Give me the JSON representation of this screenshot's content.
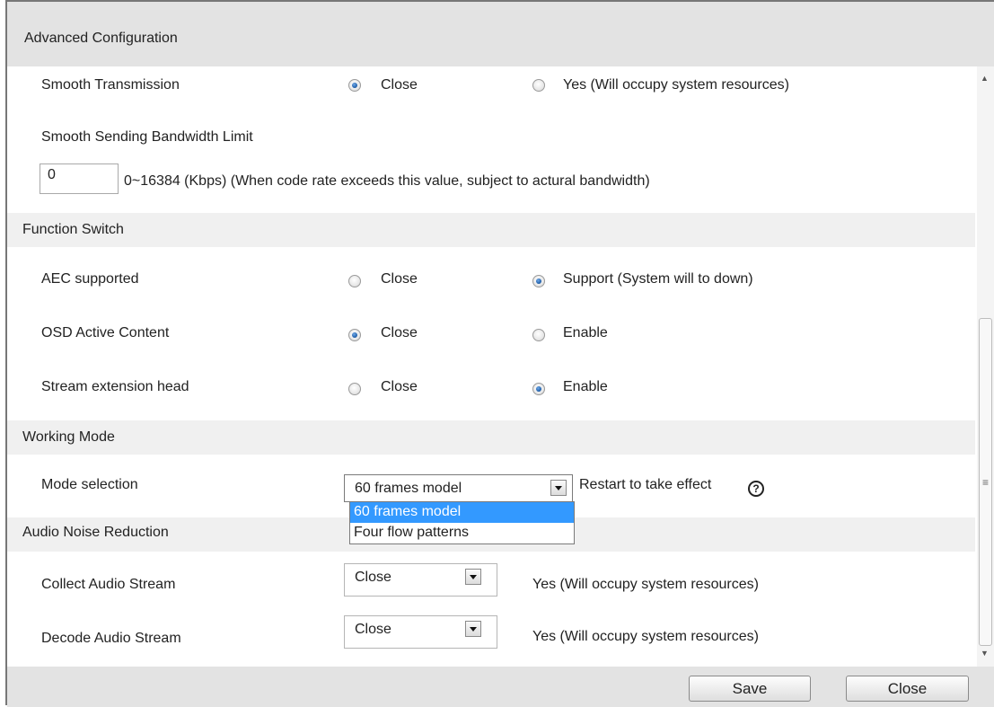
{
  "title": "Advanced Configuration",
  "smooth_transmission": {
    "label": "Smooth Transmission",
    "options": [
      "Close",
      "Yes (Will occupy system resources)"
    ],
    "selected": "Close"
  },
  "bandwidth": {
    "label": "Smooth Sending Bandwidth Limit",
    "value": "0",
    "hint": "0~16384  (Kbps) (When code rate exceeds this value, subject to actural bandwidth)"
  },
  "function_switch": {
    "title": "Function Switch",
    "rows": [
      {
        "label": "AEC supported",
        "options": [
          "Close",
          "Support (System will to down)"
        ],
        "selected": 1
      },
      {
        "label": "OSD Active Content",
        "options": [
          "Close",
          "Enable"
        ],
        "selected": 0
      },
      {
        "label": "Stream extension head",
        "options": [
          "Close",
          "Enable"
        ],
        "selected": 1
      }
    ]
  },
  "working_mode": {
    "title": "Working Mode",
    "mode_label": "Mode selection",
    "mode_value": "60 frames model",
    "mode_hint": "Restart to take effect",
    "mode_options": [
      "60 frames model",
      "Four flow patterns"
    ]
  },
  "audio": {
    "title": "Audio Noise Reduction",
    "collect_label": "Collect Audio Stream",
    "collect_value": "Close",
    "collect_note": "Yes (Will occupy system resources)",
    "decode_label": "Decode Audio Stream",
    "decode_value": "Close",
    "decode_note": "Yes (Will occupy system resources)"
  },
  "footer": {
    "save": "Save",
    "close": "Close"
  },
  "icons": {
    "help": "?",
    "scroll_up": "▲",
    "scroll_down": "▼",
    "grip": "≡"
  }
}
